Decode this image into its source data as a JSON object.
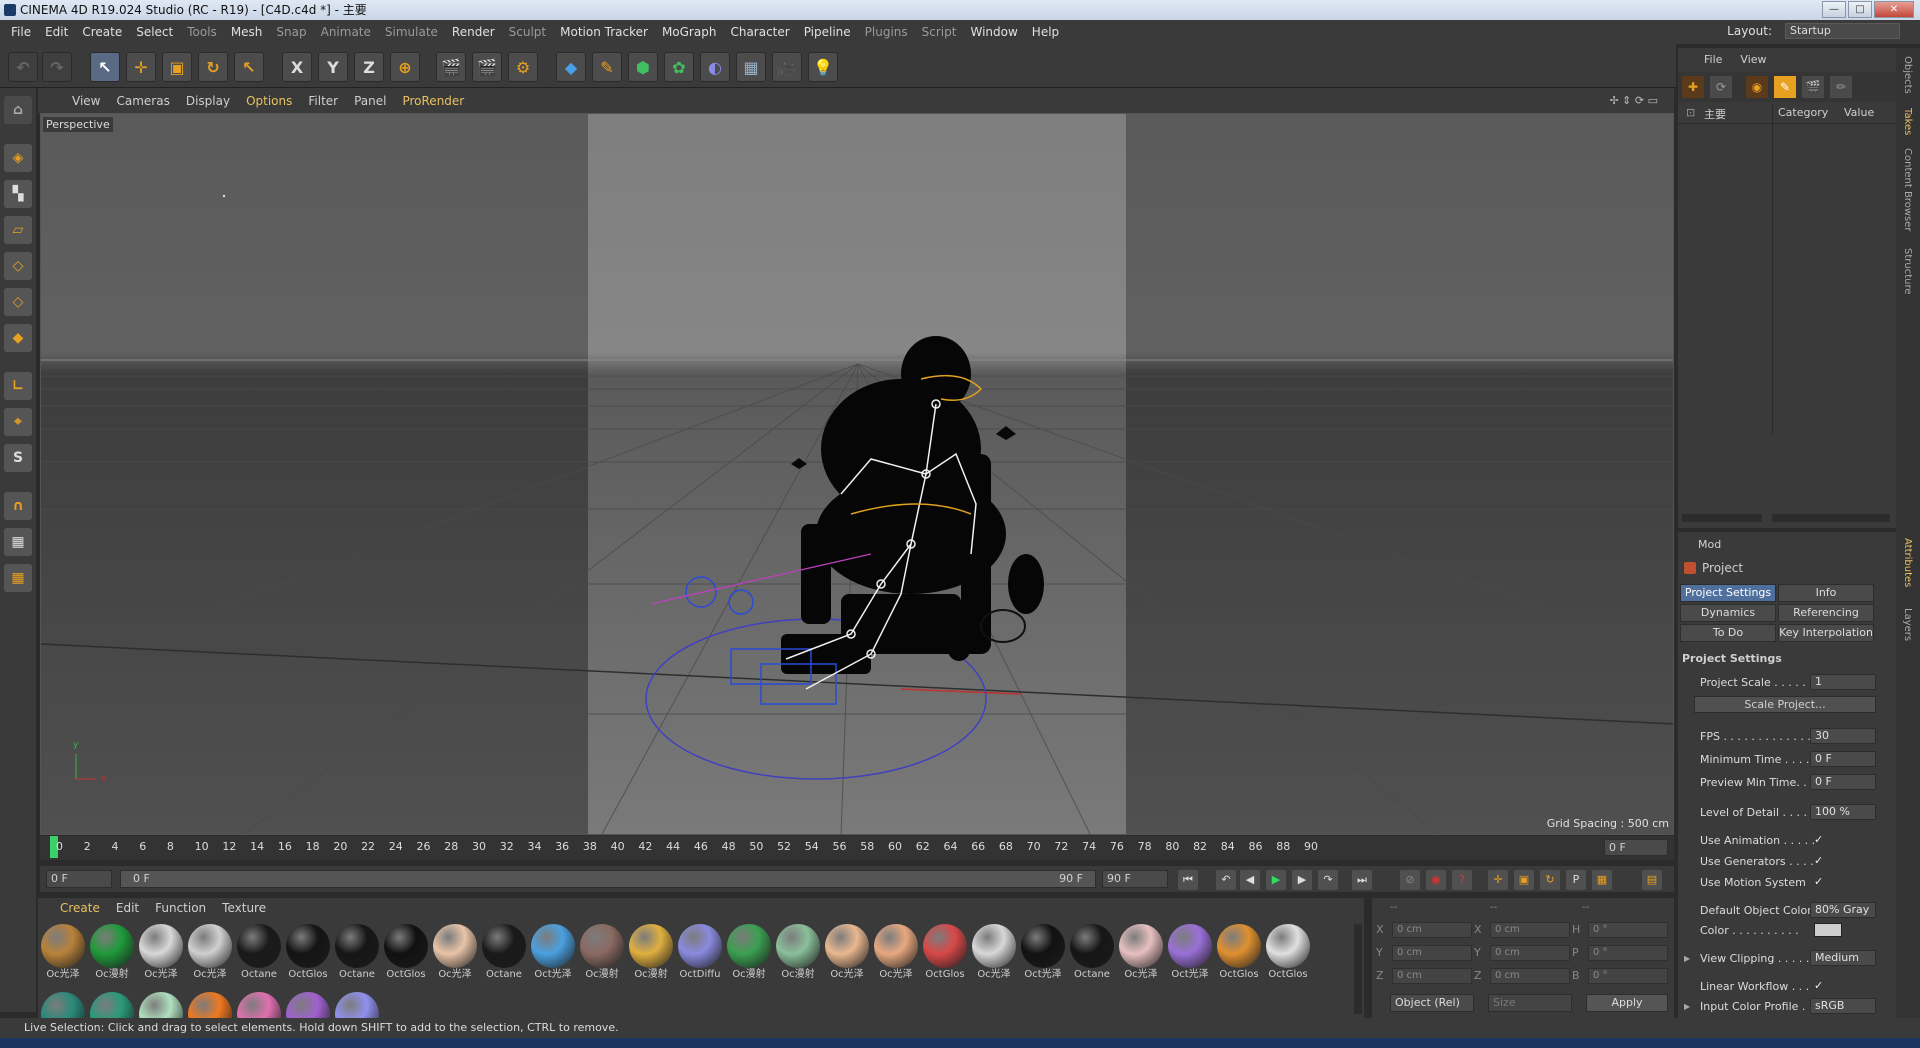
{
  "window": {
    "title": "CINEMA 4D R19.024 Studio (RC - R19) - [C4D.c4d *] - 主要",
    "min": "—",
    "max": "□",
    "close": "✕"
  },
  "menu": {
    "items": [
      "File",
      "Edit",
      "Create",
      "Select",
      "Tools",
      "Mesh",
      "Snap",
      "Animate",
      "Simulate",
      "Render",
      "Sculpt",
      "Motion Tracker",
      "MoGraph",
      "Character",
      "Pipeline",
      "Plugins",
      "Script",
      "Window",
      "Help"
    ],
    "layout_label": "Layout:",
    "layout_value": "Startup"
  },
  "toolbar": {
    "x_label": "X",
    "y_label": "Y",
    "z_label": "Z"
  },
  "viewport": {
    "menu": [
      "View",
      "Cameras",
      "Display",
      "Options",
      "Filter",
      "Panel",
      "ProRender"
    ],
    "label": "Perspective",
    "grid_spacing": "Grid Spacing : 500 cm",
    "axis_y": "y",
    "axis_x": "x"
  },
  "timeline": {
    "ticks": [
      "0",
      "2",
      "4",
      "6",
      "8",
      "10",
      "12",
      "14",
      "16",
      "18",
      "20",
      "22",
      "24",
      "26",
      "28",
      "30",
      "32",
      "34",
      "36",
      "38",
      "40",
      "42",
      "44",
      "46",
      "48",
      "50",
      "52",
      "54",
      "56",
      "58",
      "60",
      "62",
      "64",
      "66",
      "68",
      "70",
      "72",
      "74",
      "76",
      "78",
      "80",
      "82",
      "84",
      "86",
      "88",
      "90"
    ],
    "current_frame": "0 F"
  },
  "playback": {
    "start": "0 F",
    "range_start": "0 F",
    "range_end": "90 F",
    "end": "90 F"
  },
  "material_manager": {
    "menu": [
      "Create",
      "Edit",
      "Function",
      "Texture"
    ],
    "materials": [
      {
        "label": "Oc光泽",
        "color": "#b8823a"
      },
      {
        "label": "Oc漫射",
        "color": "#1f9a3a"
      },
      {
        "label": "Oc光泽",
        "color": "#d8d8d8"
      },
      {
        "label": "Oc光泽",
        "color": "#d0d0d0"
      },
      {
        "label": "Octane",
        "color": "#1a1a1a"
      },
      {
        "label": "OctGlos",
        "color": "#141414"
      },
      {
        "label": "Octane",
        "color": "#161616"
      },
      {
        "label": "OctGlos",
        "color": "#111111"
      },
      {
        "label": "Oc光泽",
        "color": "#e8c4a8"
      },
      {
        "label": "Octane",
        "color": "#1a1a1a"
      },
      {
        "label": "Oct光泽",
        "color": "#4aa0e0"
      },
      {
        "label": "Oc漫射",
        "color": "#8a6a62"
      },
      {
        "label": "Oc漫射",
        "color": "#e0b040"
      },
      {
        "label": "OctDiffu",
        "color": "#8a8ae0"
      },
      {
        "label": "Oc漫射",
        "color": "#3aa050"
      },
      {
        "label": "Oc漫射",
        "color": "#8ac09a"
      },
      {
        "label": "Oc光泽",
        "color": "#eab890"
      },
      {
        "label": "Oc光泽",
        "color": "#e8a880"
      },
      {
        "label": "OctGlos",
        "color": "#d84848"
      },
      {
        "label": "Oc光泽",
        "color": "#d8d8d8"
      },
      {
        "label": "Oct光泽",
        "color": "#121212"
      },
      {
        "label": "Octane",
        "color": "#161616"
      },
      {
        "label": "Oc光泽",
        "color": "#e8c0c0"
      },
      {
        "label": "Oct光泽",
        "color": "#9a70d8"
      },
      {
        "label": "OctGlos",
        "color": "#e09030"
      },
      {
        "label": "OctGlos",
        "color": "#e0e0e0"
      }
    ],
    "row2": [
      {
        "color": "#2a8a7a"
      },
      {
        "color": "#2a9a7a"
      },
      {
        "color": "#b0e0c0"
      },
      {
        "color": "#f07820"
      },
      {
        "color": "#e070b0"
      },
      {
        "color": "#a060d0"
      },
      {
        "color": "#9090f0"
      }
    ]
  },
  "coordinates": {
    "header": [
      "--",
      "--",
      "--"
    ],
    "rows": [
      {
        "a": "X",
        "av": "0 cm",
        "b": "X",
        "bv": "0 cm",
        "c": "H",
        "cv": "0 °"
      },
      {
        "a": "Y",
        "av": "0 cm",
        "b": "Y",
        "bv": "0 cm",
        "c": "P",
        "cv": "0 °"
      },
      {
        "a": "Z",
        "av": "0 cm",
        "b": "Z",
        "bv": "0 cm",
        "c": "B",
        "cv": "0 °"
      }
    ],
    "mode": "Object (Rel)",
    "size": "Size",
    "apply": "Apply"
  },
  "object_manager": {
    "menu": [
      "File",
      "View"
    ],
    "col_name": "主要",
    "col_category": "Category",
    "col_value": "Value"
  },
  "attributes": {
    "menu": "Mod",
    "object": "Project",
    "tabs": [
      "Project Settings",
      "Info",
      "Dynamics",
      "Referencing",
      "To Do",
      "Key Interpolation"
    ],
    "section": "Project Settings",
    "project_scale_label": "Project Scale . . . . . .",
    "project_scale": "1",
    "scale_button": "Scale Project...",
    "fps_label": "FPS . . . . . . . . . . . . . .",
    "fps": "30",
    "min_time_label": "Minimum Time . . . .",
    "min_time": "0 F",
    "preview_min_label": "Preview Min Time. . .",
    "preview_min": "0 F",
    "lod_label": "Level of Detail . . . . .",
    "lod": "100 %",
    "use_animation": "Use Animation . . . . .",
    "use_generators": "Use Generators . . . .",
    "use_motion": "Use Motion System",
    "check": "✓",
    "default_color_label": "Default Object Color",
    "default_color": "80% Gray",
    "color_label": "Color . . . . . . . . . .",
    "view_clipping_label": "View Clipping . . . . .",
    "view_clipping": "Medium",
    "linear_workflow": "Linear Workflow . . .",
    "input_profile_label": "Input Color Profile . .",
    "input_profile": "sRGB"
  },
  "side_tabs": [
    "Objects",
    "Takes",
    "Content Browser",
    "Structure",
    "Attributes",
    "Layers"
  ],
  "status": "Live Selection: Click and drag to select elements. Hold down SHIFT to add to the selection, CTRL to remove."
}
